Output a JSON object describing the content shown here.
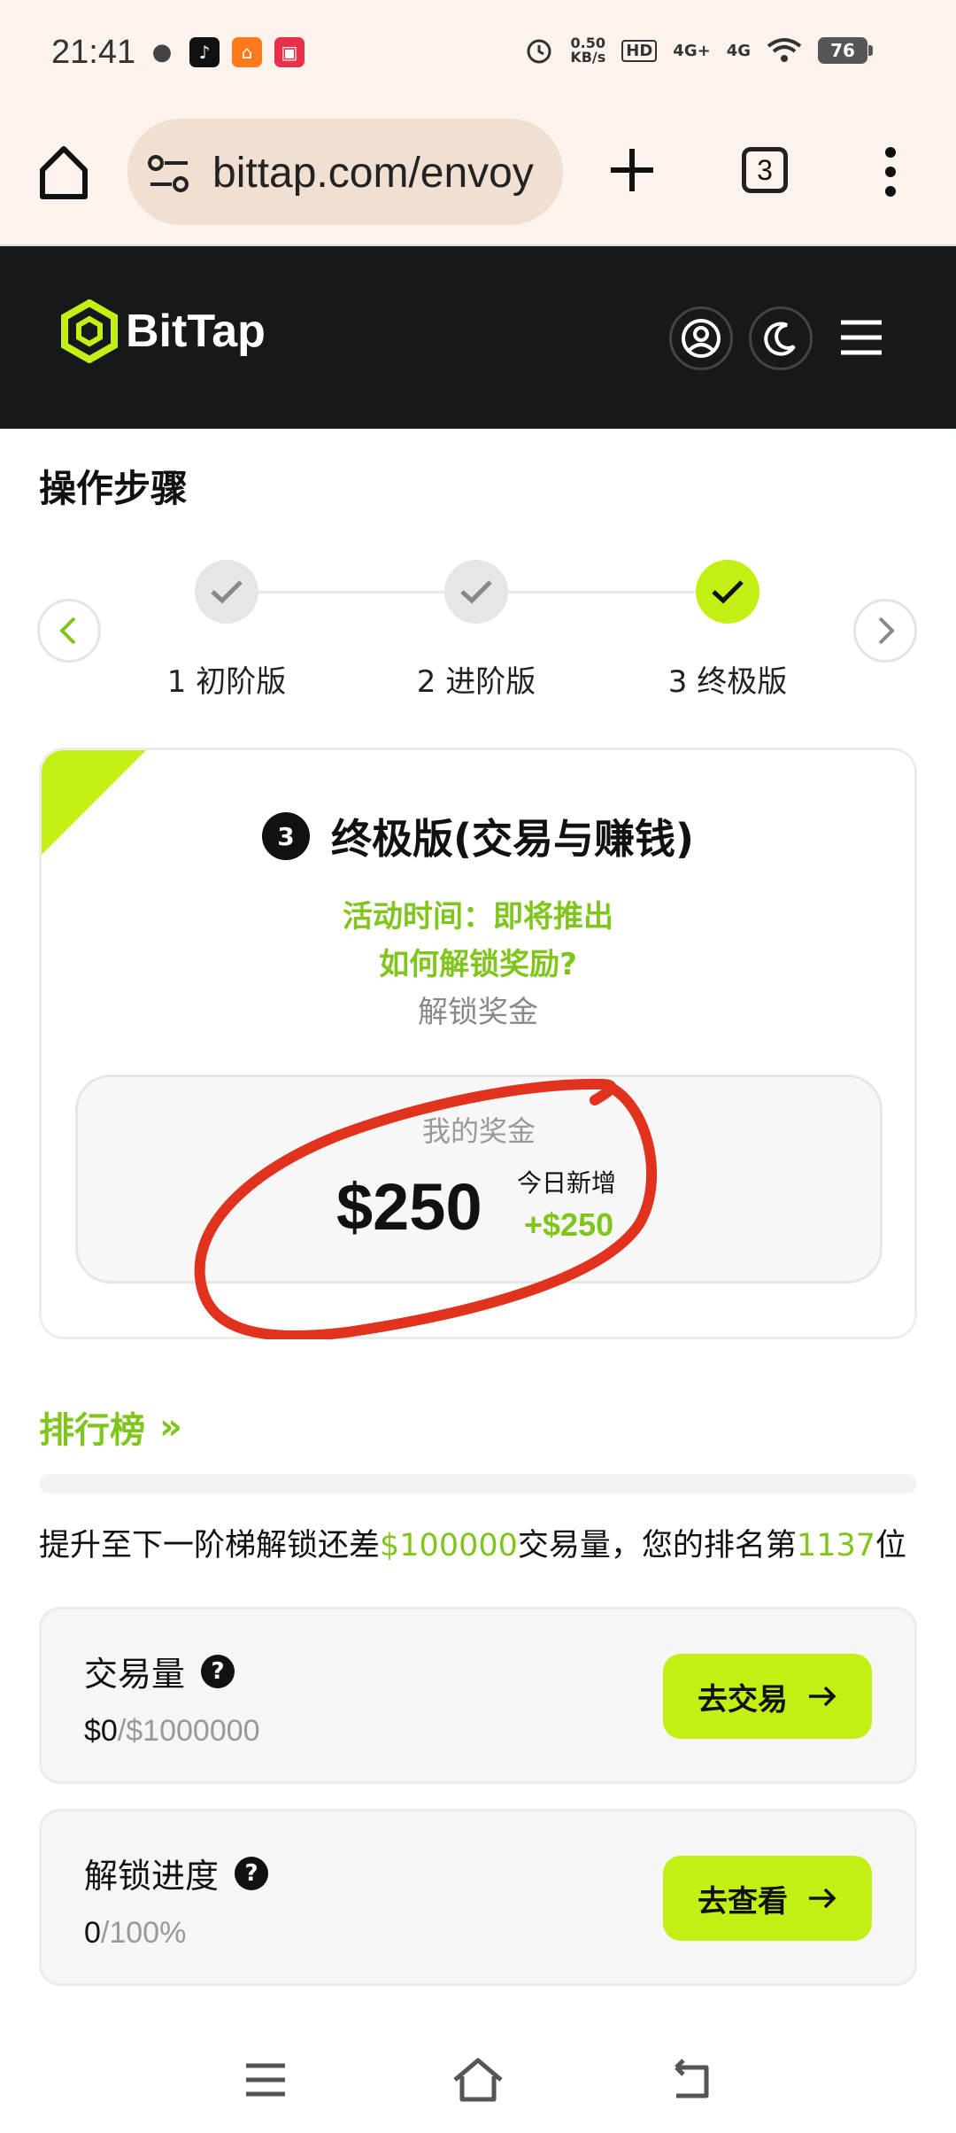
{
  "status_bar": {
    "time": "21:41",
    "net_speed_value": "0.50",
    "net_speed_unit": "KB/s",
    "hd": "HD",
    "signal1": "4G+",
    "signal2": "4G",
    "battery": "76",
    "icons": [
      "wechat-icon",
      "tiktok-icon",
      "app-orange-icon",
      "app-red-icon",
      "alarm-icon",
      "wifi-icon"
    ]
  },
  "browser": {
    "url": "bittap.com/envoy",
    "tab_count": "3"
  },
  "site": {
    "logo_text": "BitTap",
    "accent_color": "#c3f014"
  },
  "steps": {
    "title": "操作步骤",
    "items": [
      {
        "label": "1 初阶版",
        "state": "done"
      },
      {
        "label": "2 进阶版",
        "state": "done"
      },
      {
        "label": "3 终极版",
        "state": "active"
      }
    ]
  },
  "card": {
    "badge": "3",
    "title": "终极版(交易与赚钱)",
    "activity_time": "活动时间：即将推出",
    "how_to_unlock": "如何解锁奖励?",
    "unlock_bonus": "解锁奖金",
    "my_bonus_label": "我的奖金",
    "my_bonus_amount": "$250",
    "today_label": "今日新增",
    "today_amount": "+$250"
  },
  "leaderboard": {
    "link": "排行榜",
    "arrow": "»",
    "info_prefix": "提升至下一阶梯解锁还差",
    "info_amount": "$100000",
    "info_mid": "交易量，您的排名第",
    "info_rank": "1137",
    "info_suffix": "位"
  },
  "metrics": [
    {
      "title": "交易量",
      "help": "?",
      "value": "$0",
      "target": "/$1000000",
      "button": "去交易"
    },
    {
      "title": "解锁进度",
      "help": "?",
      "value": "0",
      "target": "/100%",
      "button": "去查看"
    }
  ]
}
